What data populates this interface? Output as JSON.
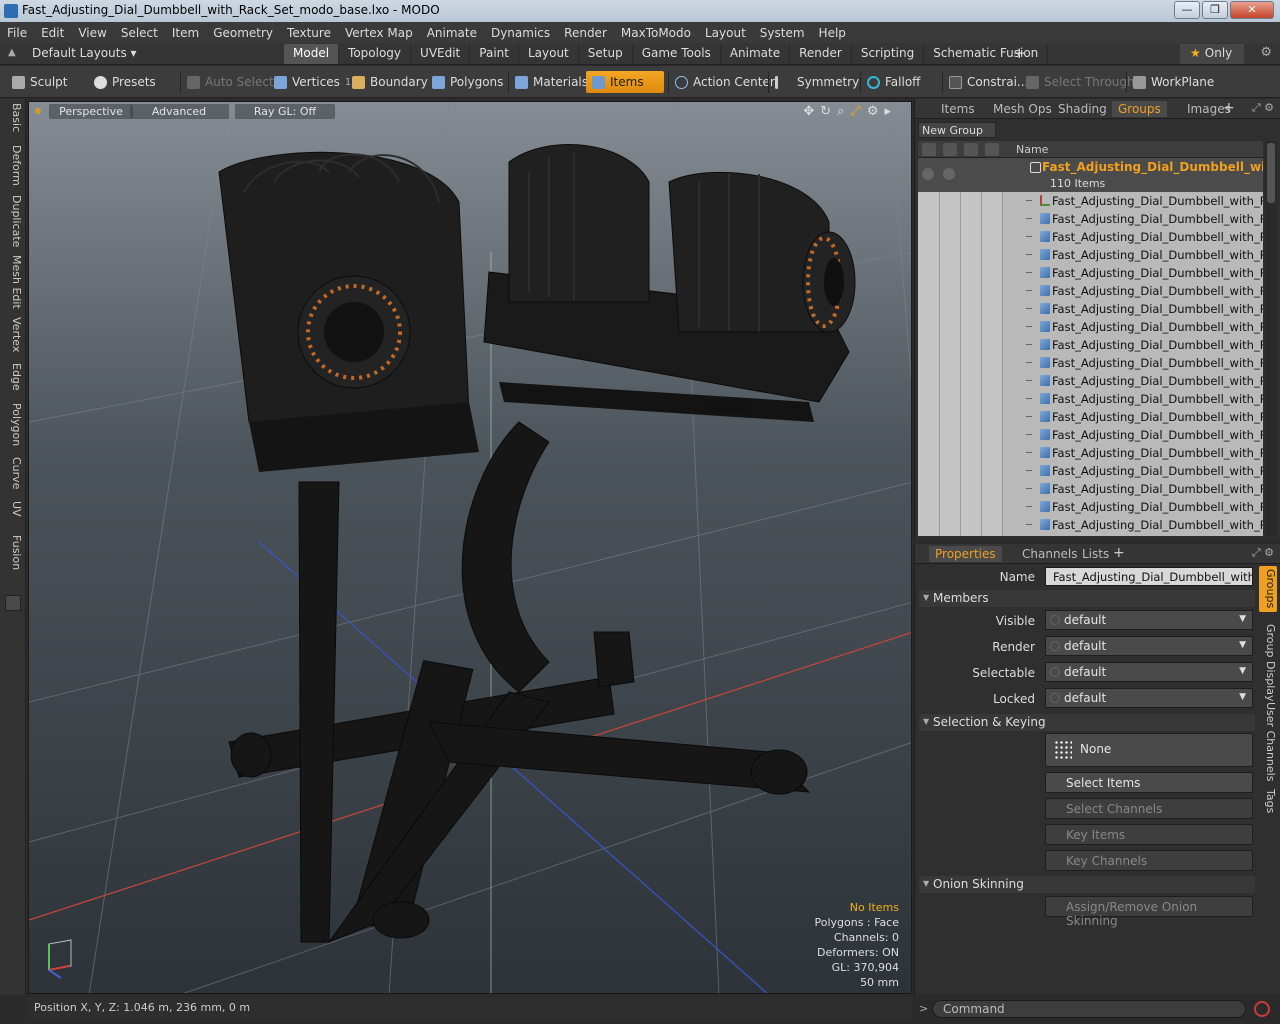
{
  "window": {
    "title": "Fast_Adjusting_Dial_Dumbbell_with_Rack_Set_modo_base.lxo - MODO",
    "buttons": [
      "—",
      "❐",
      "✕"
    ]
  },
  "menu": [
    "File",
    "Edit",
    "View",
    "Select",
    "Item",
    "Geometry",
    "Texture",
    "Vertex Map",
    "Animate",
    "Dynamics",
    "Render",
    "MaxToModo",
    "Layout",
    "System",
    "Help"
  ],
  "layoutbar": {
    "layouts_label": "Default Layouts ▾",
    "tabs": [
      "Model",
      "Topology",
      "UVEdit",
      "Paint",
      "Layout",
      "Setup",
      "Game Tools",
      "Animate",
      "Render",
      "Scripting",
      "Schematic Fusion"
    ],
    "active_tab": "Model",
    "plus": "+",
    "only_label": "Only"
  },
  "toolbar": {
    "sculpt": "Sculpt",
    "presets": "Presets",
    "auto_select": "Auto Select",
    "vertices": "Vertices",
    "vertices_count": "1",
    "boundary": "Boundary",
    "polygons": "Polygons",
    "materials": "Materials",
    "items": "Items",
    "action_center": "Action Center",
    "symmetry": "Symmetry",
    "falloff": "Falloff",
    "constraints": "Constrai...",
    "select_through": "Select Through",
    "workplane": "WorkPlane"
  },
  "left_tabs": [
    "Basic",
    "Deform",
    "Duplicate",
    "Mesh Edit",
    "Vertex",
    "Edge",
    "Polygon",
    "Curve",
    "UV",
    "Fusion"
  ],
  "viewport": {
    "view": "Perspective",
    "shading": "Advanced",
    "raygl": "Ray GL: Off",
    "hud": {
      "selection": "No Items",
      "polygons": "Polygons : Face",
      "channels": "Channels: 0",
      "deformers": "Deformers: ON",
      "gl": "GL: 370,904",
      "scale": "50 mm"
    },
    "colors": {
      "grid_red": "#c8473a",
      "grid_blue": "#3a55c8",
      "accent": "#f0a020"
    }
  },
  "status": {
    "position": "Position X, Y, Z:   1.046 m, 236 mm, 0 m"
  },
  "groups_panel": {
    "tabs": [
      "Items",
      "Mesh Ops",
      "Shading",
      "Groups",
      "Images"
    ],
    "active_tab": "Groups",
    "new_group": "New Group",
    "column_name": "Name",
    "group": {
      "name": "Fast_Adjusting_Dial_Dumbbell_with...",
      "count": "110 Items"
    },
    "children": [
      "Fast_Adjusting_Dial_Dumbbell_with_Rac...",
      "Fast_Adjusting_Dial_Dumbbell_with_Rac...",
      "Fast_Adjusting_Dial_Dumbbell_with_Rac...",
      "Fast_Adjusting_Dial_Dumbbell_with_Rac...",
      "Fast_Adjusting_Dial_Dumbbell_with_Rac...",
      "Fast_Adjusting_Dial_Dumbbell_with_Rac...",
      "Fast_Adjusting_Dial_Dumbbell_with_Rac...",
      "Fast_Adjusting_Dial_Dumbbell_with_Rac...",
      "Fast_Adjusting_Dial_Dumbbell_with_Rac...",
      "Fast_Adjusting_Dial_Dumbbell_with_Rac...",
      "Fast_Adjusting_Dial_Dumbbell_with_Rac...",
      "Fast_Adjusting_Dial_Dumbbell_with_Rac...",
      "Fast_Adjusting_Dial_Dumbbell_with_Rac...",
      "Fast_Adjusting_Dial_Dumbbell_with_Rac...",
      "Fast_Adjusting_Dial_Dumbbell_with_Rac...",
      "Fast_Adjusting_Dial_Dumbbell_with_Rac...",
      "Fast_Adjusting_Dial_Dumbbell_with_Rac...",
      "Fast_Adjusting_Dial_Dumbbell_with_Rac...",
      "Fast_Adjusting_Dial_Dumbbell_with_Rac..."
    ]
  },
  "properties": {
    "tabs": [
      "Properties",
      "Channels",
      "Lists"
    ],
    "active_tab": "Properties",
    "name_label": "Name",
    "name_value": "Fast_Adjusting_Dial_Dumbbell_with_Rack",
    "members_section": "Members",
    "visible_label": "Visible",
    "visible_value": "default",
    "render_label": "Render",
    "render_value": "default",
    "selectable_label": "Selectable",
    "selectable_value": "default",
    "locked_label": "Locked",
    "locked_value": "default",
    "selection_section": "Selection & Keying",
    "none_button": "None",
    "select_items": "Select Items",
    "select_channels": "Select Channels",
    "key_items": "Key Items",
    "key_channels": "Key Channels",
    "onion_section": "Onion Skinning",
    "onion_button": "Assign/Remove Onion Skinning",
    "side_tabs": [
      "Groups",
      "Group Display",
      "User Channels",
      "Tags"
    ]
  },
  "command": {
    "placeholder": "Command"
  }
}
